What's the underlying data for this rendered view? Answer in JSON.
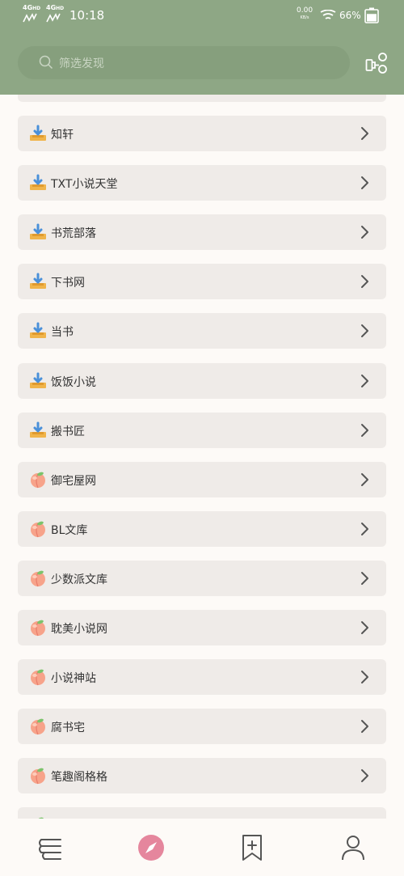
{
  "status_bar": {
    "net1": "4G",
    "net1_sup": "HD",
    "net2": "4G",
    "net2_sup": "HD",
    "time": "10:18",
    "speed_value": "0.00",
    "speed_unit": "KB/s",
    "battery": "66%",
    "battery_level": 0.66
  },
  "search": {
    "placeholder": "筛选发现"
  },
  "colors": {
    "header_bg": "#8ea785",
    "row_bg": "#efebe8",
    "page_bg": "#fdfaf7",
    "accent": "#e5869d"
  },
  "sources": [
    {
      "label": "知轩",
      "icon": "download-tray-icon"
    },
    {
      "label": "TXT小说天堂",
      "icon": "download-tray-icon"
    },
    {
      "label": "书荒部落",
      "icon": "download-tray-icon"
    },
    {
      "label": "下书网",
      "icon": "download-tray-icon"
    },
    {
      "label": "当书",
      "icon": "download-tray-icon"
    },
    {
      "label": "饭饭小说",
      "icon": "download-tray-icon"
    },
    {
      "label": "搬书匠",
      "icon": "download-tray-icon"
    },
    {
      "label": "御宅屋网",
      "icon": "peach-icon"
    },
    {
      "label": "BL文库",
      "icon": "peach-icon"
    },
    {
      "label": "少数派文库",
      "icon": "peach-icon"
    },
    {
      "label": "耽美小说网",
      "icon": "peach-icon"
    },
    {
      "label": "小说神站",
      "icon": "peach-icon"
    },
    {
      "label": "腐书宅",
      "icon": "peach-icon"
    },
    {
      "label": "笔趣阁格格",
      "icon": "peach-icon"
    },
    {
      "label": "",
      "icon": "peach-icon"
    }
  ],
  "bottom_nav": [
    {
      "name": "bookshelf",
      "icon": "bookshelf-icon",
      "active": false
    },
    {
      "name": "explore",
      "icon": "compass-icon",
      "active": true
    },
    {
      "name": "rss",
      "icon": "bookmark-add-icon",
      "active": false
    },
    {
      "name": "profile",
      "icon": "person-icon",
      "active": false
    }
  ]
}
